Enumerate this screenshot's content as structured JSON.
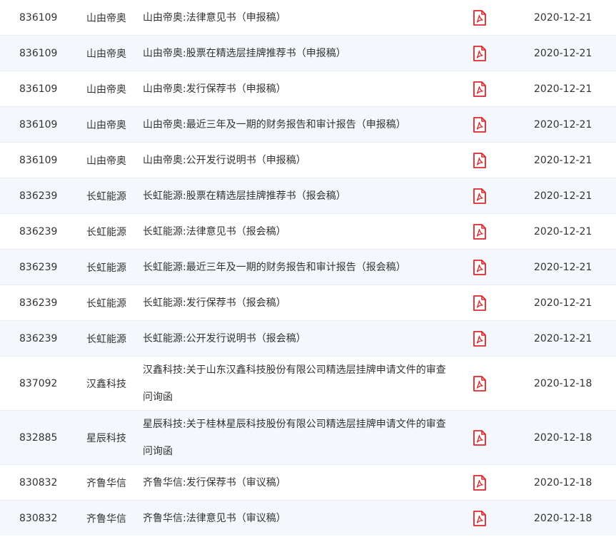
{
  "rows": [
    {
      "code": "836109",
      "name": "山由帝奥",
      "title": [
        "山由帝奥:法律意见书（申报稿）"
      ],
      "date": "2020-12-21"
    },
    {
      "code": "836109",
      "name": "山由帝奥",
      "title": [
        "山由帝奥:股票在精选层挂牌推荐书（申报稿）"
      ],
      "date": "2020-12-21"
    },
    {
      "code": "836109",
      "name": "山由帝奥",
      "title": [
        "山由帝奥:发行保荐书（申报稿）"
      ],
      "date": "2020-12-21"
    },
    {
      "code": "836109",
      "name": "山由帝奥",
      "title": [
        "山由帝奥:最近三年及一期的财务报告和审计报告（申报稿）"
      ],
      "date": "2020-12-21"
    },
    {
      "code": "836109",
      "name": "山由帝奥",
      "title": [
        "山由帝奥:公开发行说明书（申报稿）"
      ],
      "date": "2020-12-21"
    },
    {
      "code": "836239",
      "name": "长虹能源",
      "title": [
        "长虹能源:股票在精选层挂牌推荐书（报会稿）"
      ],
      "date": "2020-12-21"
    },
    {
      "code": "836239",
      "name": "长虹能源",
      "title": [
        "长虹能源:法律意见书（报会稿）"
      ],
      "date": "2020-12-21"
    },
    {
      "code": "836239",
      "name": "长虹能源",
      "title": [
        "长虹能源:最近三年及一期的财务报告和审计报告（报会稿）"
      ],
      "date": "2020-12-21"
    },
    {
      "code": "836239",
      "name": "长虹能源",
      "title": [
        "长虹能源:发行保荐书（报会稿）"
      ],
      "date": "2020-12-21"
    },
    {
      "code": "836239",
      "name": "长虹能源",
      "title": [
        "长虹能源:公开发行说明书（报会稿）"
      ],
      "date": "2020-12-21"
    },
    {
      "code": "837092",
      "name": "汉鑫科技",
      "title": [
        "汉鑫科技:关于山东汉鑫科技股份有限公司精选层挂牌申请文件的审查",
        "问询函"
      ],
      "date": "2020-12-18"
    },
    {
      "code": "832885",
      "name": "星辰科技",
      "title": [
        "星辰科技:关于桂林星辰科技股份有限公司精选层挂牌申请文件的审查",
        "问询函"
      ],
      "date": "2020-12-18"
    },
    {
      "code": "830832",
      "name": "齐鲁华信",
      "title": [
        "齐鲁华信:发行保荐书（审议稿）"
      ],
      "date": "2020-12-18"
    },
    {
      "code": "830832",
      "name": "齐鲁华信",
      "title": [
        "齐鲁华信:法律意见书（审议稿）"
      ],
      "date": "2020-12-18"
    }
  ],
  "icons": {
    "pdf": "pdf-icon"
  },
  "colors": {
    "pdf_red": "#e0252b",
    "row_alt": "#f4f7fb",
    "text": "#333333"
  }
}
